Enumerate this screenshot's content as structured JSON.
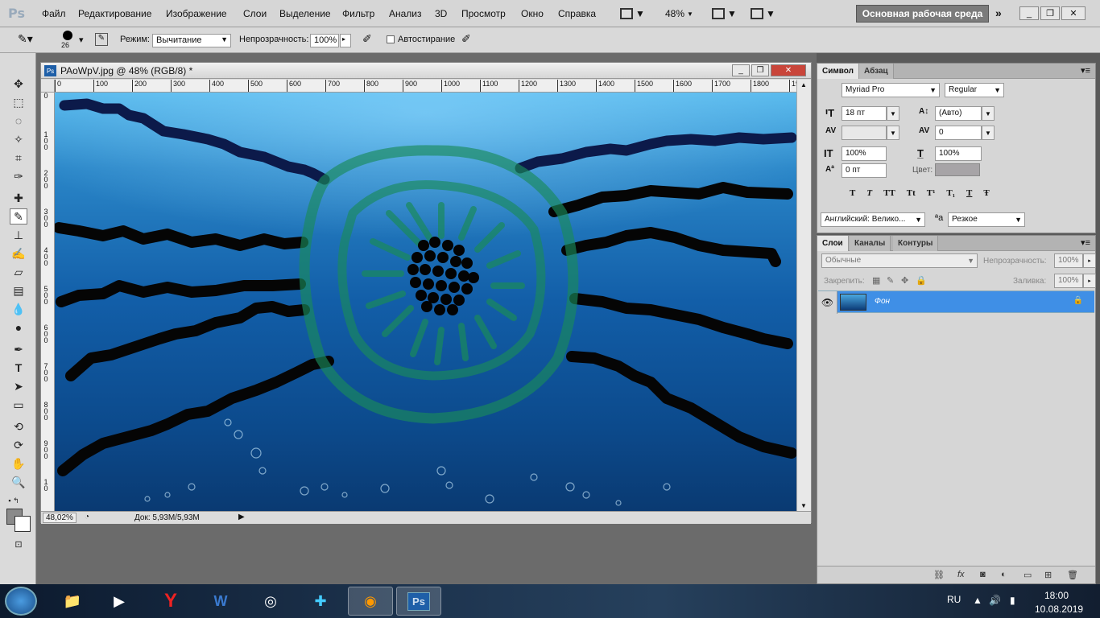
{
  "app": {
    "logo": "Ps"
  },
  "menu": [
    "Файл",
    "Редактирование",
    "Изображение",
    "Слои",
    "Выделение",
    "Фильтр",
    "Анализ",
    "3D",
    "Просмотр",
    "Окно",
    "Справка"
  ],
  "menubar": {
    "zoom": "48%",
    "workspace": "Основная рабочая среда"
  },
  "options": {
    "brush_size": "26",
    "mode_label": "Режим:",
    "mode_value": "Вычитание",
    "opacity_label": "Непрозрачность:",
    "opacity_value": "100%",
    "auto_erase_label": "Автостирание"
  },
  "document": {
    "title": "PAoWpV.jpg @ 48% (RGB/8) *",
    "zoom": "48,02%",
    "info": "Док: 5,93M/5,93M",
    "ruler_h": [
      "0",
      "100",
      "200",
      "300",
      "400",
      "500",
      "600",
      "700",
      "800",
      "900",
      "1000",
      "1100",
      "1200",
      "1300",
      "1400",
      "1500",
      "1600",
      "1700",
      "1800",
      "19"
    ],
    "ruler_v": [
      "0",
      "1 0 0",
      "2 0 0",
      "3 0 0",
      "4 0 0",
      "5 0 0",
      "6 0 0",
      "7 0 0",
      "8 0 0",
      "9 0 0",
      "1 0"
    ]
  },
  "char_panel": {
    "tabs": [
      "Символ",
      "Абзац"
    ],
    "font_family": "Myriad Pro",
    "font_style": "Regular",
    "size": "18 пт",
    "leading": "(Авто)",
    "kerning": "",
    "tracking": "0",
    "vscale": "100%",
    "hscale": "100%",
    "baseline": "0 пт",
    "color_label": "Цвет:",
    "style_buttons": [
      "T",
      "T",
      "TT",
      "Tt",
      "T¹",
      "T₁",
      "T",
      "Ŧ"
    ],
    "language": "Английский: Велико...",
    "aa_icon": "ªa",
    "antialias": "Резкое"
  },
  "layers_panel": {
    "tabs": [
      "Слои",
      "Каналы",
      "Контуры"
    ],
    "blend_mode": "Обычные",
    "opacity_label": "Непрозрачность:",
    "opacity_value": "100%",
    "lock_label": "Закрепить:",
    "fill_label": "Заливка:",
    "fill_value": "100%",
    "layer_name": "Фон"
  },
  "taskbar": {
    "lang": "RU",
    "time": "18:00",
    "date": "10.08.2019"
  },
  "colors": {
    "accent": "#3f8fe6",
    "fg": "#8a8a8a",
    "bg": "#ffffff"
  }
}
